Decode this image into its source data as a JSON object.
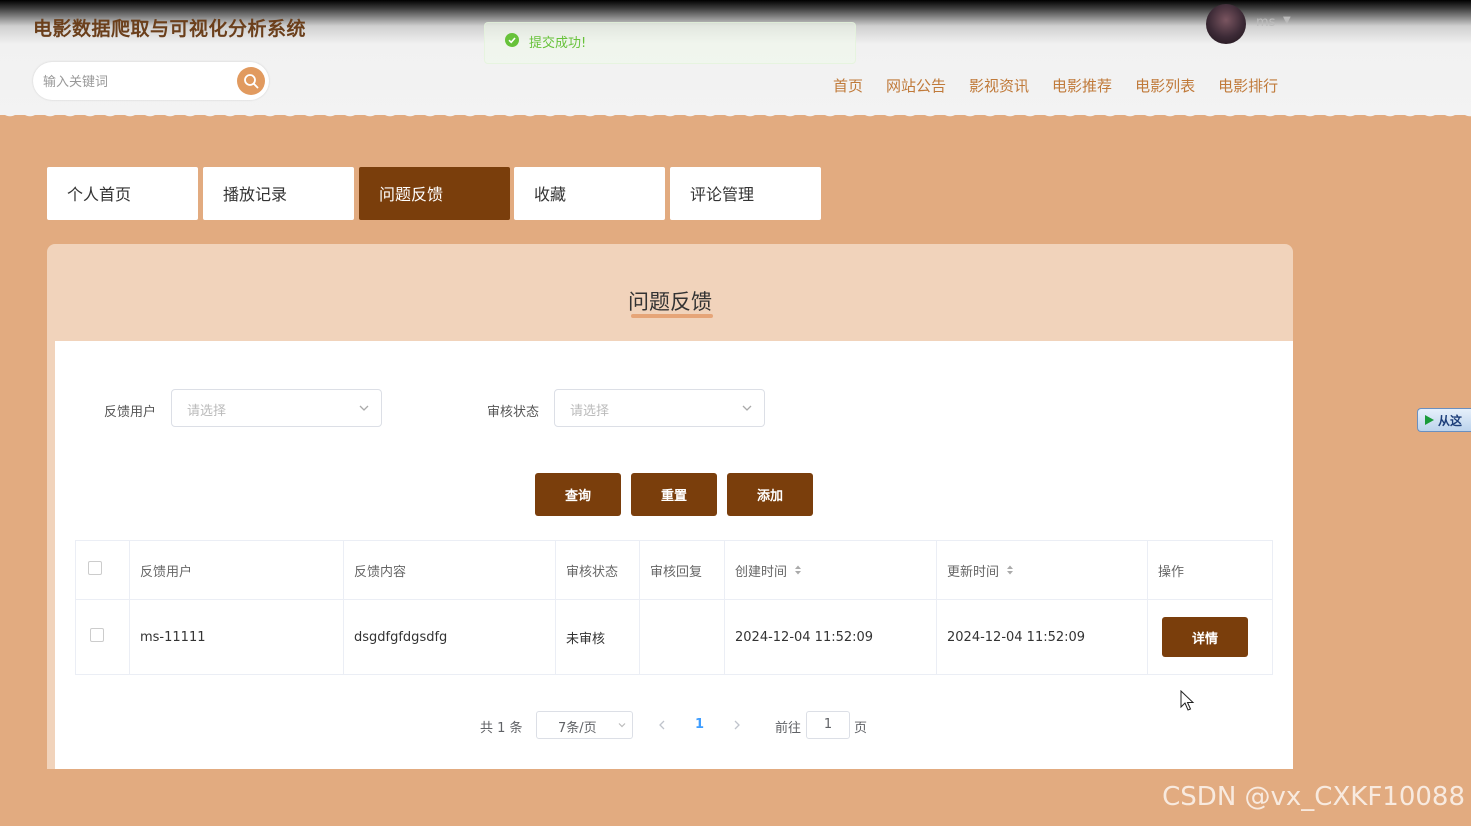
{
  "header": {
    "site_title": "电影数据爬取与可视化分析系统",
    "search_placeholder": "输入关键词",
    "toast_message": "提交成功!",
    "username": "ms",
    "nav": [
      "首页",
      "网站公告",
      "影视资讯",
      "电影推荐",
      "电影列表",
      "电影排行"
    ]
  },
  "tabs": [
    {
      "label": "个人首页",
      "active": false
    },
    {
      "label": "播放记录",
      "active": false
    },
    {
      "label": "问题反馈",
      "active": true
    },
    {
      "label": "收藏",
      "active": false
    },
    {
      "label": "评论管理",
      "active": false
    }
  ],
  "page_title": "问题反馈",
  "filters": {
    "user_label": "反馈用户",
    "user_placeholder": "请选择",
    "status_label": "审核状态",
    "status_placeholder": "请选择"
  },
  "buttons": {
    "query": "查询",
    "reset": "重置",
    "add": "添加"
  },
  "table": {
    "columns": [
      "反馈用户",
      "反馈内容",
      "审核状态",
      "审核回复",
      "创建时间",
      "更新时间",
      "操作"
    ],
    "rows": [
      {
        "user": "ms-11111",
        "content": "dsgdfgfdgsdfg",
        "status": "未审核",
        "reply": "",
        "created": "2024-12-04 11:52:09",
        "updated": "2024-12-04 11:52:09",
        "action": "详情"
      }
    ]
  },
  "pagination": {
    "total_text": "共 1 条",
    "page_size": "7条/页",
    "current_page": "1",
    "goto_prefix": "前往",
    "goto_value": "1",
    "goto_suffix": "页"
  },
  "side_widget": "从这",
  "watermark": "CSDN @vx_CXKF10088",
  "colors": {
    "accent": "#7a3e0c",
    "background": "#e2ab80",
    "nav_text": "#c07a3a",
    "success": "#67c23a"
  }
}
